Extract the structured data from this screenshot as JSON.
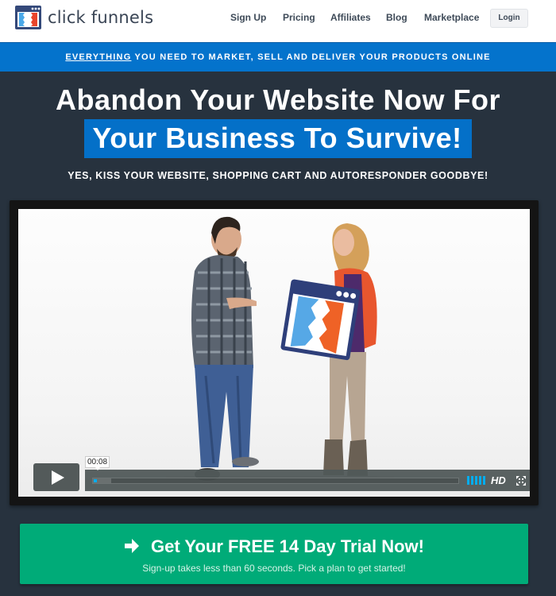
{
  "header": {
    "brand_name": "click funnels",
    "logo_icon": "clickfunnels-logo-icon",
    "nav": [
      {
        "label": "Sign Up"
      },
      {
        "label": "Pricing"
      },
      {
        "label": "Affiliates"
      },
      {
        "label": "Blog"
      },
      {
        "label": "Marketplace"
      }
    ],
    "login_label": "Login"
  },
  "banner": {
    "emphasis": "EVERYTHING",
    "rest": " YOU NEED TO MARKET, SELL AND DELIVER YOUR PRODUCTS ONLINE"
  },
  "hero": {
    "headline_line1": "Abandon Your Website Now For",
    "headline_line2": "Your Business To Survive!",
    "subheadline": "YES, KISS YOUR WEBSITE, SHOPPING CART AND AUTORESPONDER GOODBYE!"
  },
  "video": {
    "current_time": "00:08",
    "progress_fraction": 0.01,
    "hd_label": "HD",
    "volume_level": "full",
    "icons": [
      "play-icon",
      "volume-icon",
      "hd-icon",
      "fullscreen-icon"
    ]
  },
  "cta": {
    "title": "Get Your FREE 14 Day Trial Now!",
    "subtitle": "Sign-up takes less than 60 seconds. Pick a plan to get started!",
    "icon": "arrow-right-icon"
  },
  "colors": {
    "brand_blue": "#0473cc",
    "hero_bg": "#27323e",
    "cta_green": "#00ab78",
    "player_accent": "#00adef",
    "logo_red": "#e8452c",
    "logo_light_blue": "#4aa8e8",
    "logo_navy": "#2e4a7a"
  }
}
